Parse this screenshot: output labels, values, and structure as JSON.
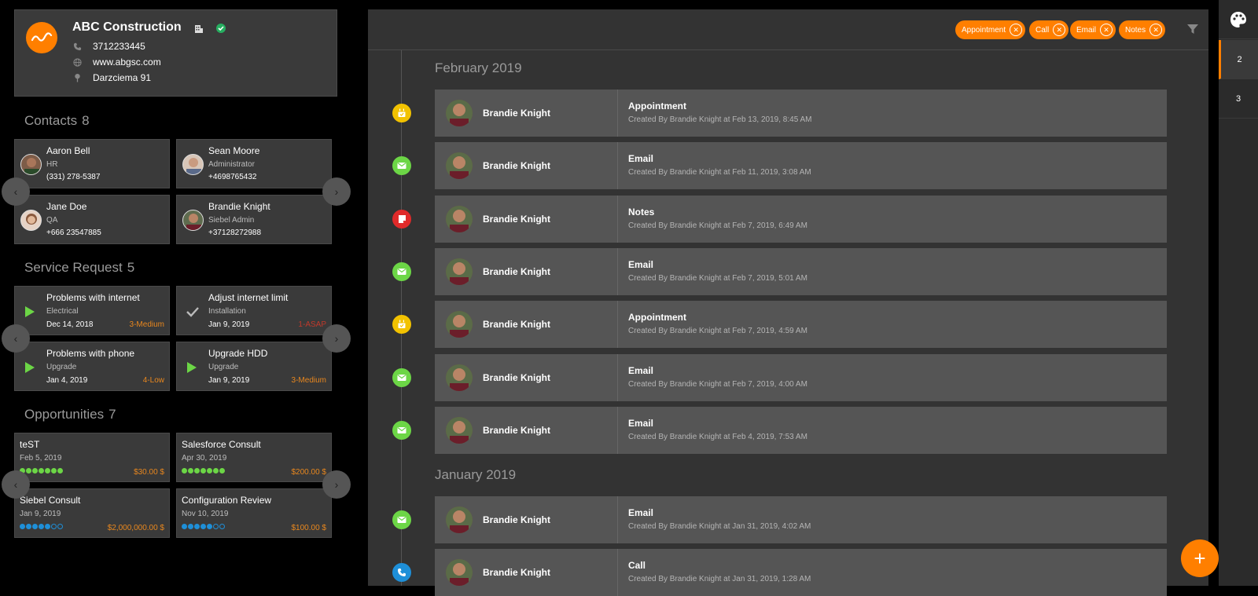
{
  "account": {
    "name": "ABC Construction",
    "phone": "3712233445",
    "website": "www.abgsc.com",
    "address": "Darzciema 91"
  },
  "contacts": {
    "title": "Contacts",
    "count": "8",
    "items": [
      {
        "name": "Aaron Bell",
        "role": "HR",
        "phone": "(331) 278-5387"
      },
      {
        "name": "Sean Moore",
        "role": "Administrator",
        "phone": "+4698765432"
      },
      {
        "name": "Jane Doe",
        "role": "QA",
        "phone": "+666 23547885"
      },
      {
        "name": "Brandie Knight",
        "role": "Siebel Admin",
        "phone": "+37128272988"
      }
    ]
  },
  "service": {
    "title": "Service Request",
    "count": "5",
    "items": [
      {
        "title": "Problems with internet",
        "category": "Electrical",
        "date": "Dec 14, 2018",
        "priority": "3-Medium",
        "status_icon": "play-icon"
      },
      {
        "title": "Adjust internet limit",
        "category": "Installation",
        "date": "Jan 9, 2019",
        "priority": "1-ASAP",
        "status_icon": "check-icon"
      },
      {
        "title": "Problems with phone",
        "category": "Upgrade",
        "date": "Jan 4, 2019",
        "priority": "4-Low",
        "status_icon": "play-icon"
      },
      {
        "title": "Upgrade HDD",
        "category": "Upgrade",
        "date": "Jan 9, 2019",
        "priority": "3-Medium",
        "status_icon": "play-icon"
      }
    ]
  },
  "opportunities": {
    "title": "Opportunities",
    "count": "7",
    "items": [
      {
        "title": "teST",
        "date": "Feb 5, 2019",
        "amount": "$30.00 $",
        "progress": 7,
        "total": 7,
        "color": "#6cd646"
      },
      {
        "title": "Salesforce Consult",
        "date": "Apr 30, 2019",
        "amount": "$200.00 $",
        "progress": 7,
        "total": 7,
        "color": "#6cd646"
      },
      {
        "title": "Siebel Consult",
        "date": "Jan 9, 2019",
        "amount": "$2,000,000.00 $",
        "progress": 5,
        "total": 7,
        "color": "#1e8fd8"
      },
      {
        "title": "Configuration Review",
        "date": "Nov 10, 2019",
        "amount": "$100.00 $",
        "progress": 5,
        "total": 7,
        "color": "#1e8fd8"
      }
    ]
  },
  "filters": [
    "Appointment",
    "Call",
    "Email",
    "Notes"
  ],
  "timeline": {
    "months": [
      "February 2019",
      "January 2019"
    ],
    "entries": [
      {
        "name": "Brandie Knight",
        "type": "Appointment",
        "created": "Created By Brandie Knight at Feb 13, 2019, 8:45 AM",
        "dot_color": "#f2c200",
        "icon": "calendar-icon"
      },
      {
        "name": "Brandie Knight",
        "type": "Email",
        "created": "Created By Brandie Knight at Feb 11, 2019, 3:08 AM",
        "dot_color": "#6cd646",
        "icon": "mail-icon"
      },
      {
        "name": "Brandie Knight",
        "type": "Notes",
        "created": "Created By Brandie Knight at Feb 7, 2019, 6:49 AM",
        "dot_color": "#e02a2a",
        "icon": "note-icon"
      },
      {
        "name": "Brandie Knight",
        "type": "Email",
        "created": "Created By Brandie Knight at Feb 7, 2019, 5:01 AM",
        "dot_color": "#6cd646",
        "icon": "mail-icon"
      },
      {
        "name": "Brandie Knight",
        "type": "Appointment",
        "created": "Created By Brandie Knight at Feb 7, 2019, 4:59 AM",
        "dot_color": "#f2c200",
        "icon": "calendar-icon"
      },
      {
        "name": "Brandie Knight",
        "type": "Email",
        "created": "Created By Brandie Knight at Feb 7, 2019, 4:00 AM",
        "dot_color": "#6cd646",
        "icon": "mail-icon"
      },
      {
        "name": "Brandie Knight",
        "type": "Email",
        "created": "Created By Brandie Knight at Feb 4, 2019, 7:53 AM",
        "dot_color": "#6cd646",
        "icon": "mail-icon"
      },
      {
        "name": "Brandie Knight",
        "type": "Email",
        "created": "Created By Brandie Knight at Jan 31, 2019, 4:02 AM",
        "dot_color": "#6cd646",
        "icon": "mail-icon"
      },
      {
        "name": "Brandie Knight",
        "type": "Call",
        "created": "Created By Brandie Knight at Jan 31, 2019, 1:28 AM",
        "dot_color": "#1e8fd8",
        "icon": "phone-icon"
      }
    ]
  },
  "rail": {
    "items": [
      "2",
      "3"
    ]
  },
  "fab_label": "+"
}
